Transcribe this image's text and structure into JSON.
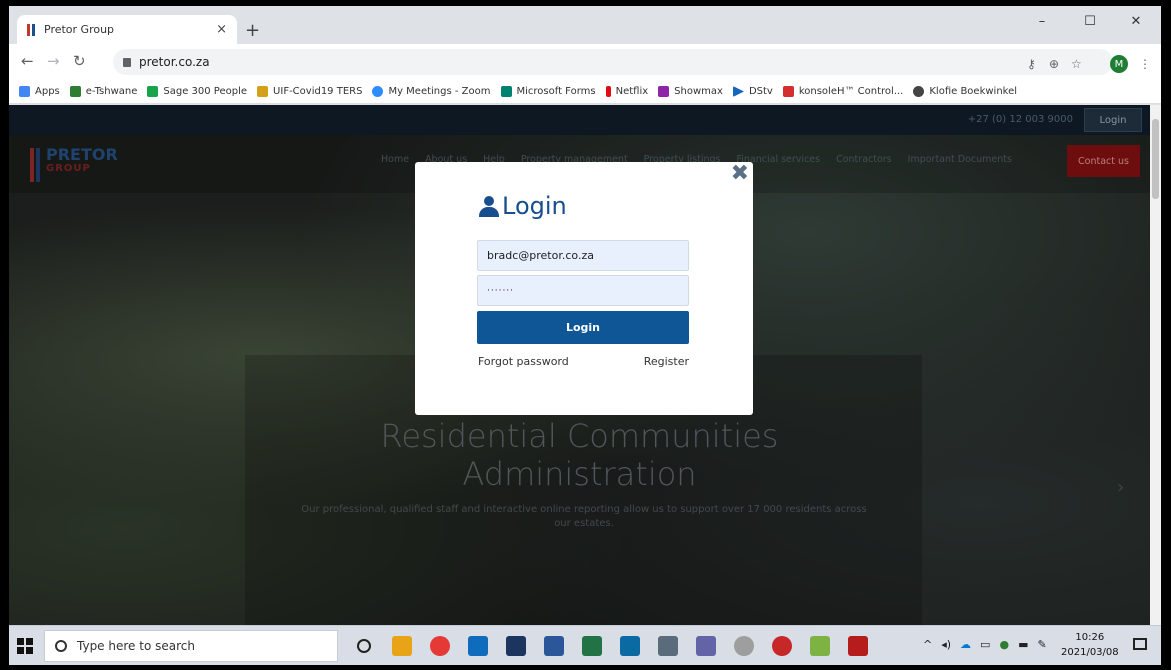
{
  "browser": {
    "tab_title": "Pretor Group",
    "tab_close": "×",
    "new_tab": "+",
    "url": "pretor.co.za",
    "profile_initial": "M",
    "window_controls": {
      "minimize": "–",
      "maximize": "☐",
      "close": "✕"
    }
  },
  "bookmarks": [
    {
      "label": "Apps",
      "color": "#4285f4"
    },
    {
      "label": "e-Tshwane",
      "color": "#2e7d32"
    },
    {
      "label": "Sage 300 People",
      "color": "#16a34a"
    },
    {
      "label": "UIF-Covid19 TERS",
      "color": "#d4a017"
    },
    {
      "label": "My Meetings - Zoom",
      "color": "#2d8cff"
    },
    {
      "label": "Microsoft Forms",
      "color": "#008272"
    },
    {
      "label": "Netflix",
      "color": "#e50914"
    },
    {
      "label": "Showmax",
      "color": "#8e24aa"
    },
    {
      "label": "DStv",
      "color": "#1565c0"
    },
    {
      "label": "konsoleH™ Control...",
      "color": "#d32f2f"
    },
    {
      "label": "Klofie Boekwinkel",
      "color": "#444444"
    }
  ],
  "site": {
    "phone": "+27 (0) 12 003 9000",
    "top_login": "Login",
    "logo_text": "PRETOR",
    "logo_sub": "GROUP",
    "nav": [
      "Home",
      "About us",
      "Help",
      "Property management",
      "Property listings",
      "Financial services",
      "Contractors",
      "Important Documents"
    ],
    "contact_button": "Contact us",
    "hero_title_1": "Residential Communities",
    "hero_title_2": "Administration",
    "hero_text": "Our professional, qualified staff and interactive online reporting allow us to support over 17 000 residents across our estates."
  },
  "modal": {
    "title": "Login",
    "close": "✖",
    "email_value": "bradc@pretor.co.za",
    "password_value": "·······",
    "login_button": "Login",
    "forgot_link": "Forgot password",
    "register_link": "Register"
  },
  "taskbar": {
    "search_placeholder": "Type here to search",
    "time": "10:26",
    "date": "2021/03/08"
  }
}
